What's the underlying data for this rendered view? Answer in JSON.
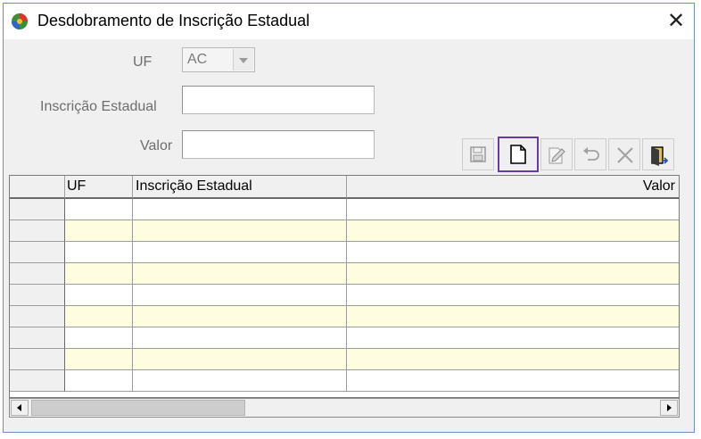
{
  "window": {
    "title": "Desdobramento de Inscrição Estadual",
    "close_glyph": "✕"
  },
  "form": {
    "uf_label": "UF",
    "uf_value": "AC",
    "inscricao_label": "Inscrição Estadual",
    "inscricao_value": "",
    "valor_label": "Valor",
    "valor_value": ""
  },
  "toolbar": {
    "buttons": [
      {
        "name": "save",
        "icon": "floppy-disk-icon",
        "enabled": false
      },
      {
        "name": "new",
        "icon": "new-document-icon",
        "enabled": true,
        "selected": true
      },
      {
        "name": "edit",
        "icon": "edit-document-icon",
        "enabled": false
      },
      {
        "name": "undo",
        "icon": "undo-icon",
        "enabled": false
      },
      {
        "name": "delete",
        "icon": "delete-x-icon",
        "enabled": false
      },
      {
        "name": "exit",
        "icon": "exit-door-icon",
        "enabled": true
      }
    ]
  },
  "grid": {
    "columns": [
      "UF",
      "Inscrição Estadual",
      "Valor"
    ],
    "rows": [
      [
        "",
        "",
        ""
      ],
      [
        "",
        "",
        ""
      ],
      [
        "",
        "",
        ""
      ],
      [
        "",
        "",
        ""
      ],
      [
        "",
        "",
        ""
      ],
      [
        "",
        "",
        ""
      ],
      [
        "",
        "",
        ""
      ],
      [
        "",
        "",
        ""
      ],
      [
        "",
        "",
        ""
      ]
    ]
  },
  "colors": {
    "row_alt": "#fffde0",
    "selection_border": "#6a3aa4",
    "window_border": "#6e8fbf"
  }
}
